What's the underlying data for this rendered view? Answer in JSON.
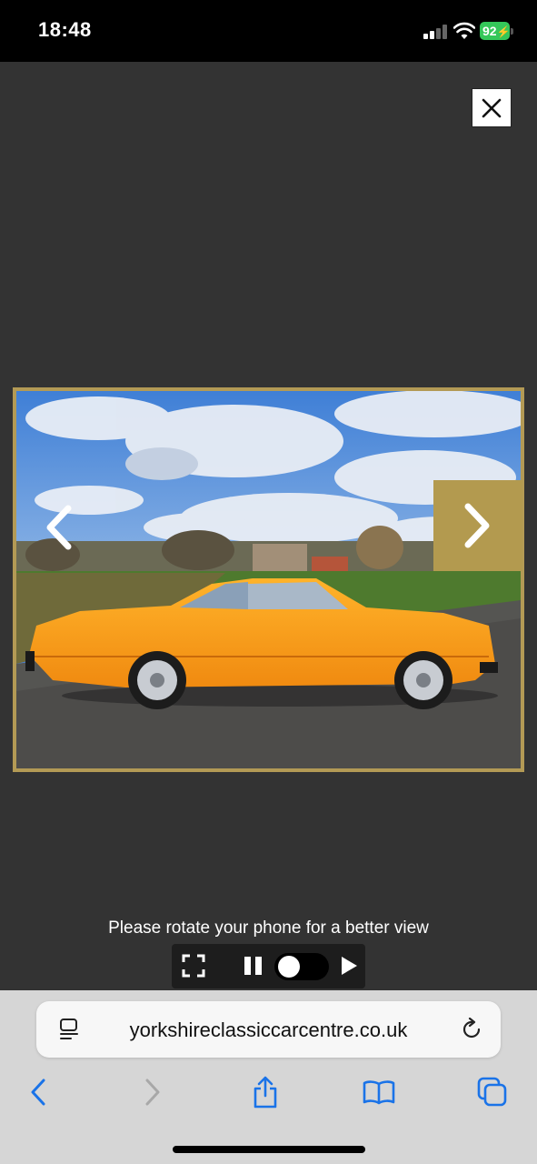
{
  "status_bar": {
    "time": "18:48",
    "battery_level": "92",
    "battery_charging": true,
    "battery_color": "#34c759",
    "signal_bars": 2,
    "wifi": true
  },
  "lightbox": {
    "close_icon": "close-icon",
    "prev_icon": "chevron-left-icon",
    "next_icon": "chevron-right-icon",
    "accent_color": "#b39a4f",
    "photo_description_icon": "photo",
    "rotate_message": "Please rotate your phone for a better view",
    "controls": {
      "fullscreen_icon": "fullscreen-icon",
      "pause_icon": "pause-icon",
      "autoplay_toggle_on": false,
      "play_icon": "play-icon"
    }
  },
  "browser": {
    "url": "yorkshireclassiccarcentre.co.uk",
    "reader_icon": "page-menu-icon",
    "reload_icon": "reload-icon",
    "toolbar": [
      "back-icon",
      "forward-icon",
      "share-icon",
      "bookmarks-icon",
      "tabs-icon"
    ],
    "link_color": "#1a73e8"
  }
}
